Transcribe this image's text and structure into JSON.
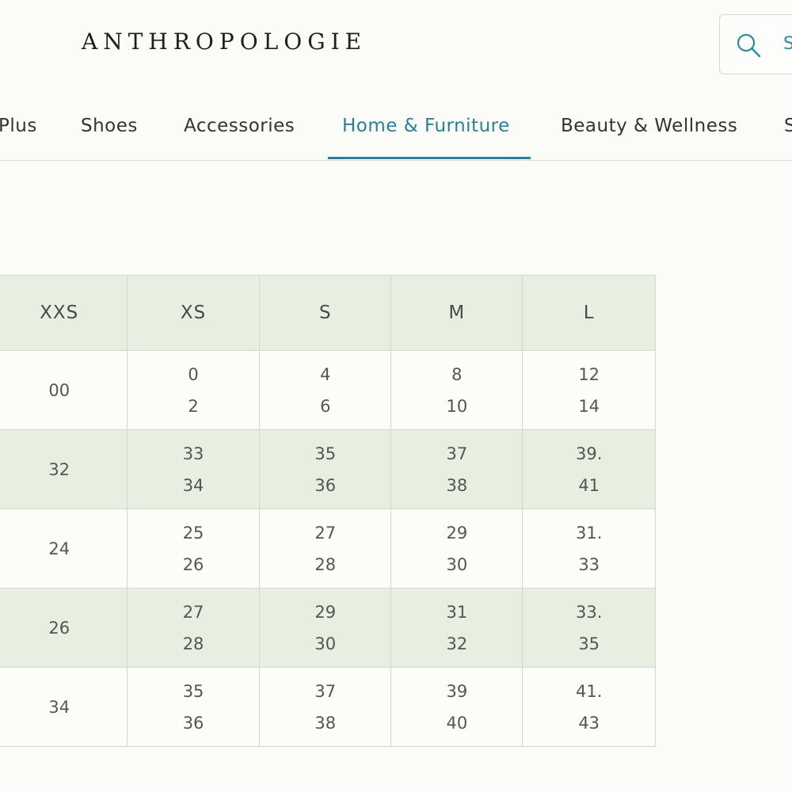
{
  "header": {
    "logo_text": "ANTHROPOLOGIE",
    "search_placeholder": "S"
  },
  "nav": {
    "items": [
      {
        "label": "Plus",
        "active": false
      },
      {
        "label": "Shoes",
        "active": false
      },
      {
        "label": "Accessories",
        "active": false
      },
      {
        "label": "Home & Furniture",
        "active": true
      },
      {
        "label": "Beauty & Wellness",
        "active": false
      },
      {
        "label": "S",
        "active": false
      }
    ]
  },
  "size_table": {
    "columns": [
      "XXS",
      "XS",
      "S",
      "M",
      "L"
    ],
    "rows": [
      {
        "cells": [
          [
            "00"
          ],
          [
            "0",
            "2"
          ],
          [
            "4",
            "6"
          ],
          [
            "8",
            "10"
          ],
          [
            "12",
            "14"
          ]
        ]
      },
      {
        "cells": [
          [
            "32"
          ],
          [
            "33",
            "34"
          ],
          [
            "35",
            "36"
          ],
          [
            "37",
            "38"
          ],
          [
            "39.",
            "41"
          ]
        ]
      },
      {
        "cells": [
          [
            "24"
          ],
          [
            "25",
            "26"
          ],
          [
            "27",
            "28"
          ],
          [
            "29",
            "30"
          ],
          [
            "31.",
            "33"
          ]
        ]
      },
      {
        "cells": [
          [
            "26"
          ],
          [
            "27",
            "28"
          ],
          [
            "29",
            "30"
          ],
          [
            "31",
            "32"
          ],
          [
            "33.",
            "35"
          ]
        ]
      },
      {
        "cells": [
          [
            "34"
          ],
          [
            "35",
            "36"
          ],
          [
            "37",
            "38"
          ],
          [
            "39",
            "40"
          ],
          [
            "41.",
            "43"
          ]
        ]
      }
    ]
  },
  "colors": {
    "accent": "#2a7f97",
    "row_shade": "#e8efe1",
    "background": "#fbfbf7"
  }
}
